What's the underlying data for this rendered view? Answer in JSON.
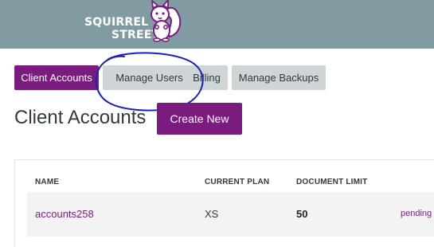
{
  "header": {
    "logo_line1": "SQUIRREL",
    "logo_line2": "STREET",
    "background_color": "#819ba3"
  },
  "tabs": [
    {
      "label": "Client Accounts",
      "active": true
    },
    {
      "label": "Manage Users",
      "active": false
    },
    {
      "label": "Billing",
      "active": false
    },
    {
      "label": "Manage Backups",
      "active": false
    }
  ],
  "page": {
    "title": "Client Accounts",
    "create_button_label": "Create New"
  },
  "table": {
    "columns": [
      "NAME",
      "CURRENT PLAN",
      "DOCUMENT LIMIT"
    ],
    "rows": [
      {
        "name": "accounts258",
        "plan": "XS",
        "limit": "50",
        "status": "pending"
      }
    ]
  },
  "colors": {
    "accent": "#7a1b7e",
    "tab_inactive": "#cfd5d6",
    "annotation": "#1a1fc4"
  },
  "icons": {
    "logo": "squirrel-logo-icon",
    "annotation": "hand-drawn-circle-annotation"
  }
}
